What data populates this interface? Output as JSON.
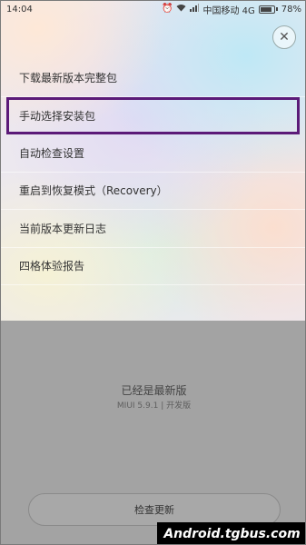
{
  "status_bar": {
    "time": "14:04",
    "carrier": "中国移动 4G",
    "battery": "78%",
    "icons": [
      "alarm-icon",
      "wifi-icon",
      "signal-icon",
      "battery-icon"
    ]
  },
  "close_icon": "✕",
  "menu": {
    "items": [
      {
        "label": "下载最新版本完整包"
      },
      {
        "label": "手动选择安装包"
      },
      {
        "label": "自动检查设置"
      },
      {
        "label": "重启到恢复模式（Recovery）"
      },
      {
        "label": "当前版本更新日志"
      },
      {
        "label": "四格体验报告"
      }
    ],
    "selected_index": 1,
    "highlight_color": "#5b1a78"
  },
  "status": {
    "title": "已经是最新版",
    "version": "MIUI 5.9.1 | 开发版"
  },
  "check_button_label": "检查更新",
  "watermark": "Android.tgbus.com"
}
